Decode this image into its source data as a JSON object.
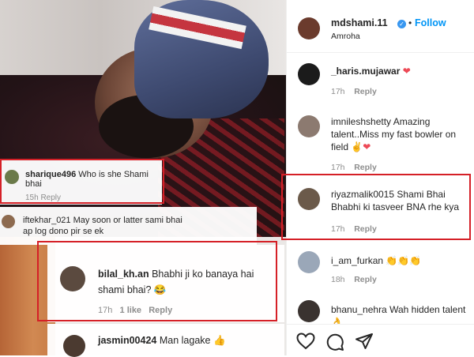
{
  "post": {
    "author": "mdshami.11",
    "separator": "•",
    "follow_label": "Follow",
    "location": "Amroha",
    "verified_glyph": "✓"
  },
  "overlays": [
    {
      "username": "sharique496",
      "text": "Who is she Shami bhai",
      "meta": "15h  Reply"
    },
    {
      "username": "iftekhar_021",
      "text": "May soon or latter sami bhai ap log dono pir se ek",
      "meta": ""
    },
    {
      "username": "bilal_kh.an",
      "text": "Bhabhi ji ko banaya hai shami bhai?",
      "emoji": "😂",
      "time": "17h",
      "likes": "1 like",
      "reply": "Reply"
    },
    {
      "username": "jasmin00424",
      "text": "Man lagake",
      "emoji": "👍"
    }
  ],
  "comments": [
    {
      "username": "_haris.mujawar",
      "text": "",
      "emoji": "❤",
      "time": "17h",
      "reply": "Reply"
    },
    {
      "username": "imnileshshetty",
      "text": "Amazing talent..Miss my fast bowler on field",
      "emoji": "✌❤",
      "time": "17h",
      "reply": "Reply"
    },
    {
      "username": "riyazmalik0015",
      "text": "Shami Bhai Bhabhi ki tasveer BNA rhe kya",
      "time": "17h",
      "reply": "Reply"
    },
    {
      "username": "i_am_furkan",
      "text": "",
      "emoji": "👏👏👏",
      "time": "18h",
      "reply": "Reply"
    },
    {
      "username": "bhanu_nehra",
      "text": "Wah hidden talent",
      "emoji": "👌",
      "time": "",
      "reply": ""
    }
  ],
  "icons": [
    "heart-icon",
    "comment-icon",
    "share-icon"
  ],
  "colors": {
    "accent": "#0095f6",
    "highlight_box": "#d52027",
    "heart": "#ed4956",
    "muted": "#8e8e8e"
  }
}
